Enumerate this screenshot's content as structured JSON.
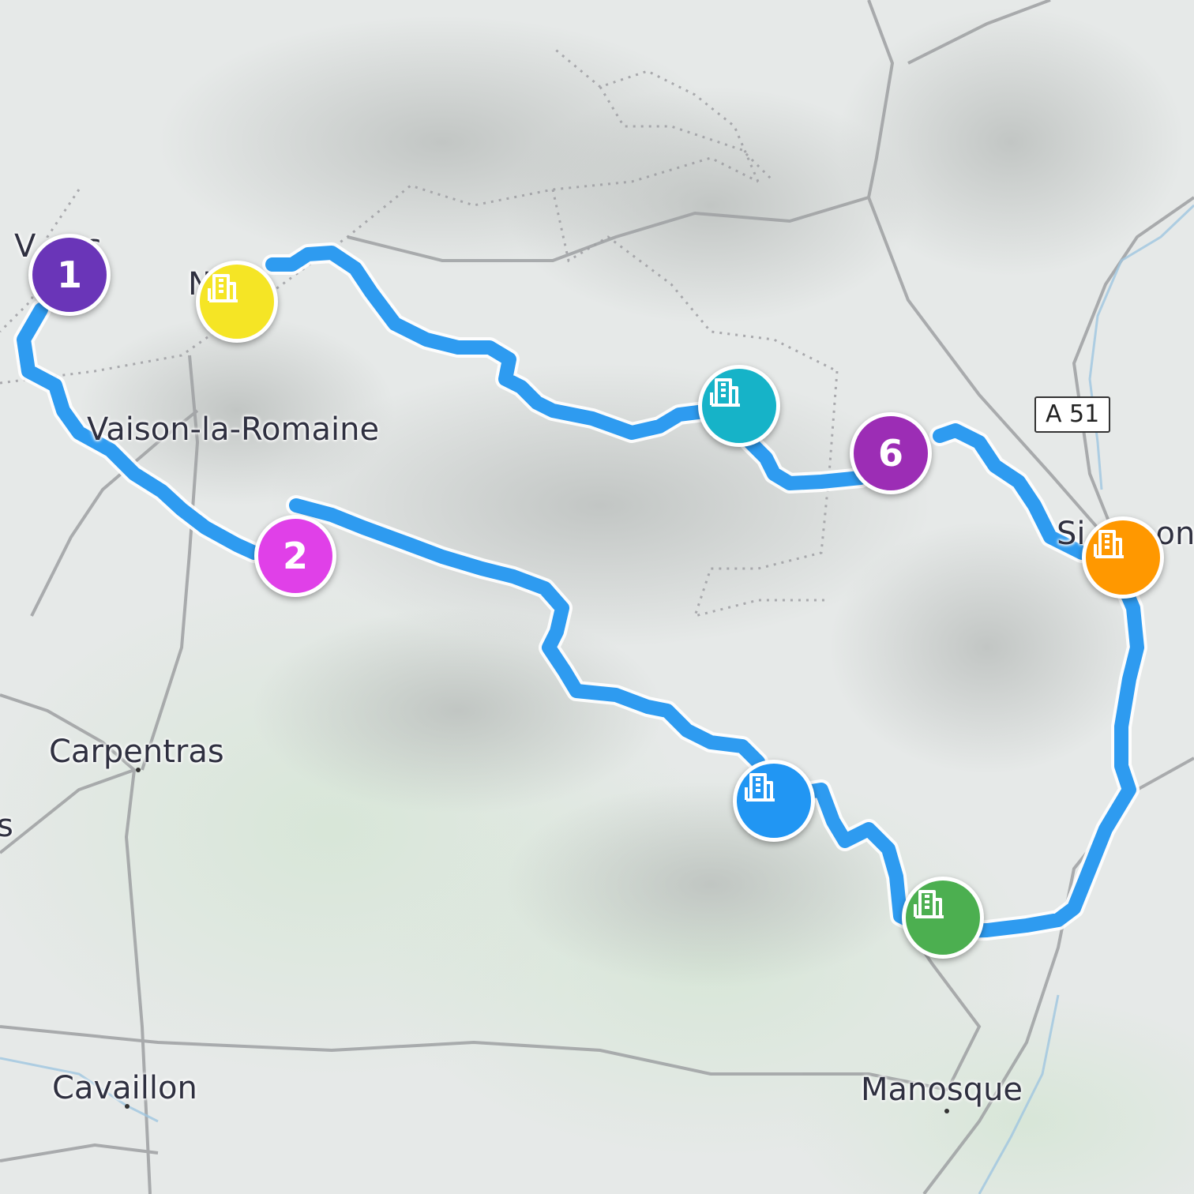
{
  "map": {
    "places": [
      {
        "id": "vaison",
        "label": "Vaison-la-Romaine"
      },
      {
        "id": "carpentras",
        "label": "Carpentras"
      },
      {
        "id": "cavaillon",
        "label": "Cavaillon"
      },
      {
        "id": "manosque",
        "label": "Manosque"
      }
    ],
    "road_shield": "A 51",
    "route_color": "#2e9bf0",
    "stops": [
      {
        "label": "1",
        "color": "#6a35b8",
        "icon": "number"
      },
      {
        "label": "2",
        "color": "#e040e8",
        "icon": "number"
      },
      {
        "label": "6",
        "color": "#9c2db5",
        "icon": "number"
      },
      {
        "label": "",
        "color": "#f5e525",
        "icon": "hotel-icon"
      },
      {
        "label": "",
        "color": "#16b3c8",
        "icon": "hotel-icon"
      },
      {
        "label": "",
        "color": "#ff9800",
        "icon": "hotel-icon"
      },
      {
        "label": "",
        "color": "#2196f3",
        "icon": "hotel-icon"
      },
      {
        "label": "",
        "color": "#4caf50",
        "icon": "hotel-icon"
      }
    ]
  }
}
